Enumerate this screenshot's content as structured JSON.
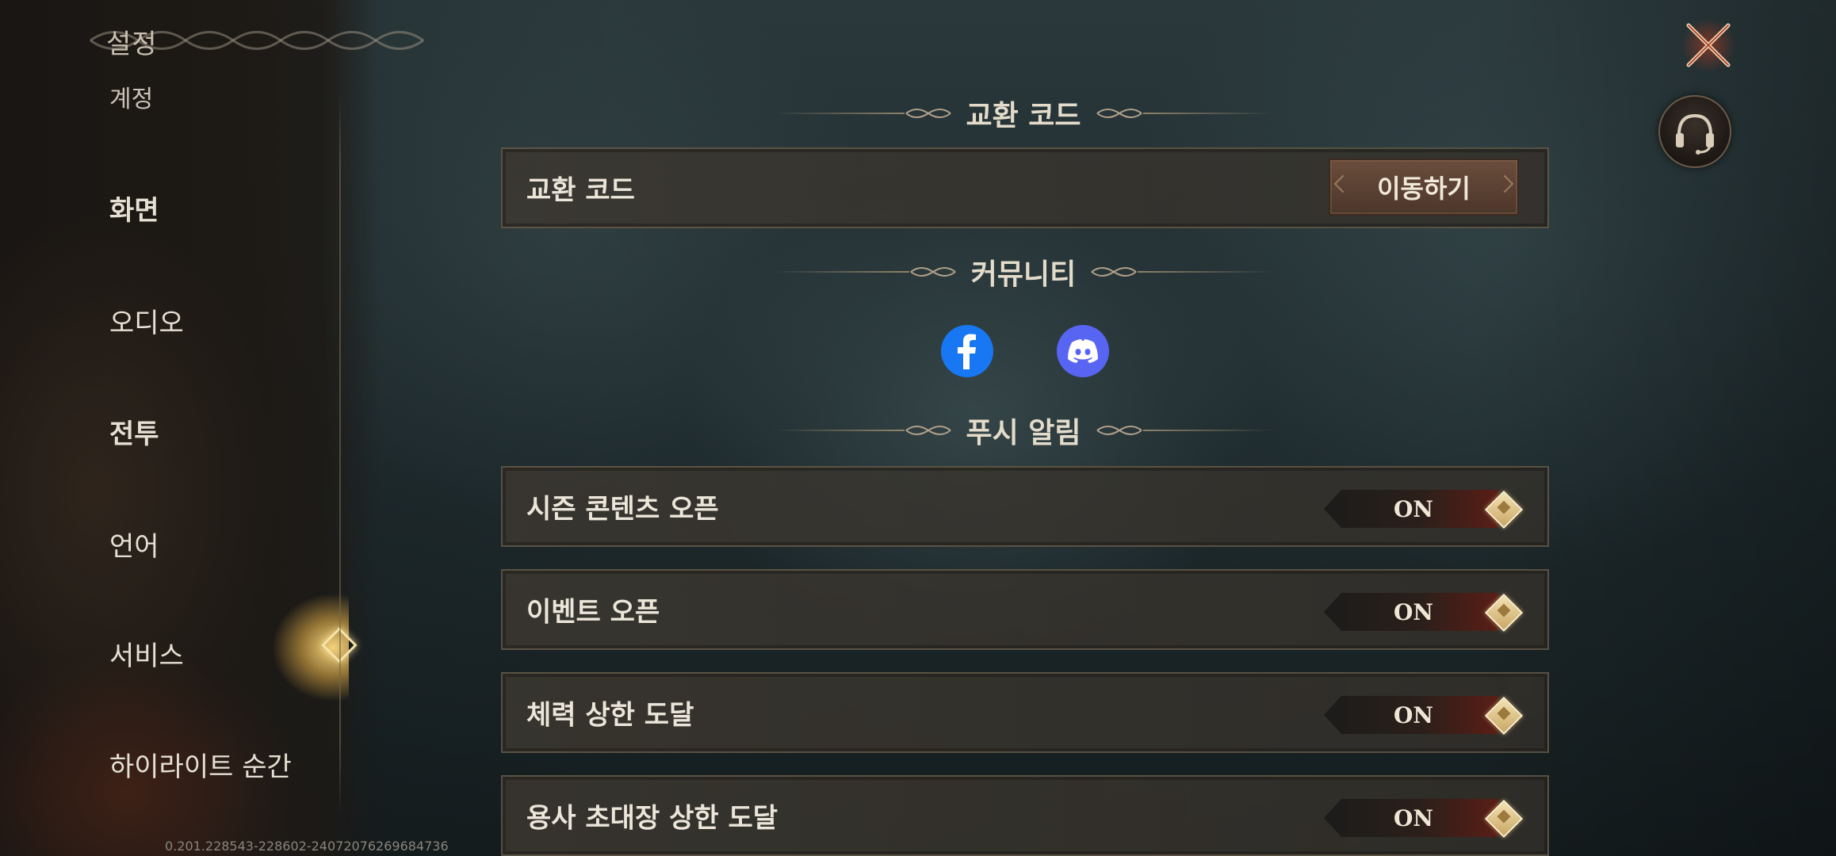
{
  "header": {
    "title": "설정"
  },
  "sidebar": {
    "items": [
      {
        "label": "계정"
      },
      {
        "label": "화면"
      },
      {
        "label": "오디오"
      },
      {
        "label": "전투"
      },
      {
        "label": "언어"
      },
      {
        "label": "서비스"
      },
      {
        "label": "하이라이트 순간"
      }
    ],
    "active_index": 5
  },
  "sections": {
    "redeem": {
      "title": "교환 코드",
      "row_label": "교환 코드",
      "button_label": "이동하기"
    },
    "community": {
      "title": "커뮤니티",
      "links": [
        {
          "icon": "facebook-icon"
        },
        {
          "icon": "discord-icon"
        }
      ]
    },
    "push": {
      "title": "푸시 알림",
      "rows": [
        {
          "label": "시즌 콘텐츠 오픈",
          "state": "ON"
        },
        {
          "label": "이벤트 오픈",
          "state": "ON"
        },
        {
          "label": "체력 상한 도달",
          "state": "ON"
        },
        {
          "label": "용사 초대장 상한 도달",
          "state": "ON"
        }
      ]
    }
  },
  "footer": {
    "version": "0.201.228543-228602-2407207626968​4736"
  },
  "colors": {
    "accent_gold": "#f6e3a6",
    "facebook": "#1877f2",
    "discord": "#5865f2",
    "toggle_on": "#5a1e16"
  }
}
